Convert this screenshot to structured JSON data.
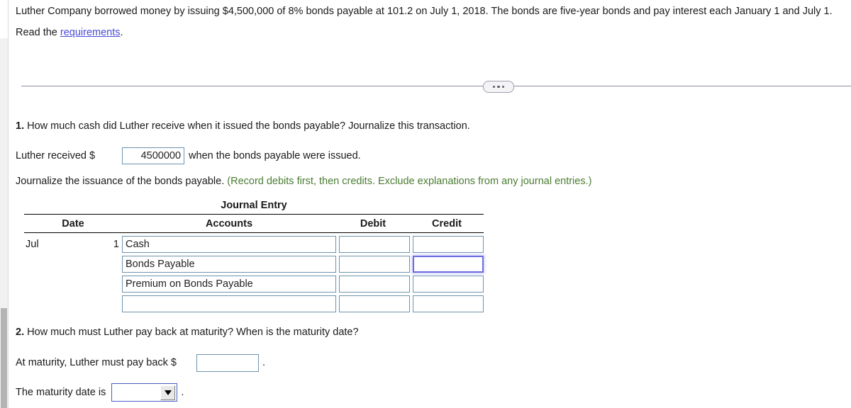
{
  "problem": {
    "statement": "Luther Company borrowed money by issuing $4,500,000 of 8% bonds payable at 101.2 on July 1, 2018. The bonds are five-year bonds and pay interest each January 1 and July 1.",
    "read_prefix": "Read the ",
    "read_link": "requirements",
    "read_suffix": "."
  },
  "divider": {
    "handle_icon": "ellipsis-handle"
  },
  "question1": {
    "number": "1.",
    "text": " How much cash did Luther receive when it issued the bonds payable? Journalize this transaction.",
    "received_prefix": "Luther received $",
    "received_value": "4500000",
    "received_suffix": "when the bonds payable were issued.",
    "journalize_text": "Journalize the issuance of the bonds payable. ",
    "journalize_hint": "(Record debits first, then credits. Exclude explanations from any journal entries.)"
  },
  "journal": {
    "title": "Journal Entry",
    "columns": [
      "Date",
      "Accounts",
      "Debit",
      "Credit"
    ],
    "rows": [
      {
        "month": "Jul",
        "day": "1",
        "account": "Cash",
        "debit": "",
        "credit": "",
        "credit_focused": false
      },
      {
        "month": "",
        "day": "",
        "account": "Bonds Payable",
        "debit": "",
        "credit": "",
        "credit_focused": true
      },
      {
        "month": "",
        "day": "",
        "account": "Premium on Bonds Payable",
        "debit": "",
        "credit": "",
        "credit_focused": false
      },
      {
        "month": "",
        "day": "",
        "account": "",
        "debit": "",
        "credit": "",
        "credit_focused": false
      }
    ]
  },
  "question2": {
    "number": "2.",
    "text": " How much must Luther pay back at maturity? When is the maturity date?",
    "payback_prefix": "At maturity, Luther must pay back $",
    "payback_value": "",
    "payback_suffix": ".",
    "maturity_prefix": "The maturity date is",
    "maturity_value": "",
    "maturity_suffix": ".",
    "dropdown_icon": "chevron-down-icon"
  },
  "colors": {
    "link": "#4a4ad8",
    "hint_green": "#4a7c32",
    "input_border": "#6e93ad",
    "focus_border": "#6d6de0"
  }
}
